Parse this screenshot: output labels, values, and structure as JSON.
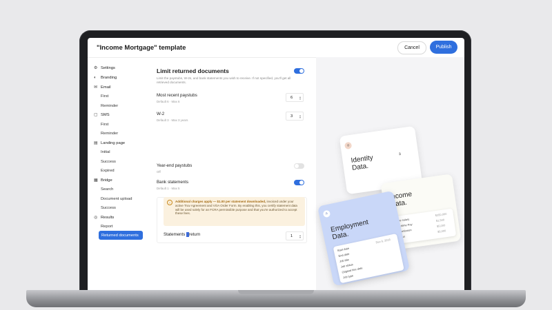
{
  "header": {
    "title": "\"Income Mortgage\" template",
    "cancel_label": "Cancel",
    "publish_label": "Publish"
  },
  "sidebar": {
    "items": [
      {
        "label": "Settings",
        "icon": "gear-icon"
      },
      {
        "label": "Branding",
        "icon": "palette-icon"
      },
      {
        "label": "Email",
        "icon": "mail-icon"
      },
      {
        "label": "First"
      },
      {
        "label": "Reminder"
      },
      {
        "label": "SMS",
        "icon": "chat-icon"
      },
      {
        "label": "First"
      },
      {
        "label": "Reminder"
      },
      {
        "label": "Landing page",
        "icon": "page-icon"
      },
      {
        "label": "Initial"
      },
      {
        "label": "Success"
      },
      {
        "label": "Expired"
      },
      {
        "label": "Bridge",
        "icon": "bridge-icon"
      },
      {
        "label": "Search"
      },
      {
        "label": "Document upload"
      },
      {
        "label": "Success"
      },
      {
        "label": "Results",
        "icon": "results-icon"
      },
      {
        "label": "Report"
      },
      {
        "label": "Returned documents"
      }
    ]
  },
  "main": {
    "heading": "Limit returned documents",
    "description": "Limit the paystubs, W-2s, and bank statements you wish to receive. If not specified, you'll get all retrieved documents.",
    "rows": [
      {
        "label": "Most recent paystubs",
        "sub": "Default 6 · Max 6",
        "value": "6"
      },
      {
        "label": "W-2",
        "sub": "Default 3 · Max 3 years",
        "value": "3"
      },
      {
        "label": "Year-end paystubs",
        "sub": "Off"
      },
      {
        "label": "Bank statements",
        "sub": "Default 1 · Max 5"
      }
    ],
    "notice": {
      "bold": "Additional charges apply — $1.00 per statement downloaded,",
      "text": " invoiced under your active Truv Agreement and VOA Order Form. By enabling this, you certify statement data will be used solely for an FCRA permissible purpose and that you're authorized to accept these fees."
    },
    "statements_label_a": "Statements ",
    "statements_label_b": "return",
    "statements_value": "1"
  },
  "preview": {
    "identity_title_1": "Identity",
    "identity_title_2": "Data.",
    "identity_value": "3",
    "income_title_1": "Income",
    "income_title_2": "Data.",
    "income_rows": [
      "Base salary",
      "Overtime Pay",
      "Commission",
      "Bonus"
    ],
    "income_vals": [
      "$350,000",
      "$1,500",
      "$5,000",
      "$5,000"
    ],
    "employment_title_1": "Employment",
    "employment_title_2": "Data.",
    "employment_rows": [
      "Start date",
      "End date",
      "Job title",
      "Job status",
      "Original hire date",
      "Job type"
    ],
    "employment_vals": [
      "Dec 6, 2016",
      "",
      "",
      "",
      "",
      ""
    ]
  },
  "colors": {
    "accent": "#2f6fde",
    "notice_bg": "#fbf1df",
    "employment_card": "#c9d7f8"
  }
}
